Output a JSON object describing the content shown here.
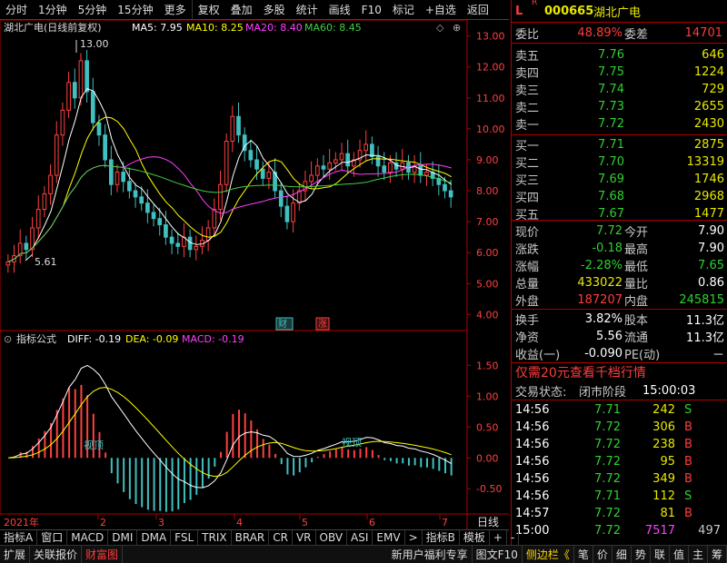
{
  "toolbar": {
    "items": [
      "分时",
      "1分钟",
      "5分钟",
      "15分钟",
      "更多",
      "复权",
      "叠加",
      "多股",
      "统计",
      "画线",
      "F10",
      "标记",
      "+自选",
      "返回"
    ]
  },
  "chart": {
    "legend": {
      "stock": "湖北广电(日线前复权)",
      "ma5": "MA5: 7.95",
      "ma10": "MA10: 8.25",
      "ma20": "MA20: 8.40",
      "ma60": "MA60: 8.45"
    },
    "max_label": "13.00",
    "min_label": "5.61",
    "price_ticks": [
      "13.00",
      "12.00",
      "11.00",
      "10.00",
      "9.00",
      "8.00",
      "7.00",
      "6.00",
      "5.00",
      "4.00"
    ],
    "markers": {
      "marker1": "财",
      "marker2": "涨"
    },
    "indicator": {
      "name": "指标公式",
      "diff": "DIFF: -0.19",
      "dea": "DEA: -0.09",
      "macd": "MACD: -0.19",
      "ticks": [
        "1.50",
        "1.00",
        "0.50",
        "0.00",
        "-0.50"
      ],
      "notes": [
        "视顶",
        "视顶"
      ]
    },
    "xaxis": {
      "year": "2021年",
      "months": [
        "2",
        "3",
        "4",
        "5",
        "6",
        "7"
      ],
      "period": "日线"
    },
    "colors": {
      "ma5": "#ffffff",
      "ma10": "#ffff00",
      "ma20": "#ff40ff",
      "ma60": "#40d040",
      "up": "#ff4040",
      "down": "#40c0c0"
    }
  },
  "panel": {
    "indicator_letter": "L",
    "r_badge": "R",
    "code": "000665",
    "name": "湖北广电",
    "weibi_label": "委比",
    "weibi_value": "48.89%",
    "weicha_label": "委差",
    "weicha_value": "14701",
    "asks": [
      {
        "label": "卖五",
        "price": "7.76",
        "vol": "646"
      },
      {
        "label": "卖四",
        "price": "7.75",
        "vol": "1224"
      },
      {
        "label": "卖三",
        "price": "7.74",
        "vol": "729"
      },
      {
        "label": "卖二",
        "price": "7.73",
        "vol": "2655"
      },
      {
        "label": "卖一",
        "price": "7.72",
        "vol": "2430"
      }
    ],
    "bids": [
      {
        "label": "买一",
        "price": "7.71",
        "vol": "2875"
      },
      {
        "label": "买二",
        "price": "7.70",
        "vol": "13319"
      },
      {
        "label": "买三",
        "price": "7.69",
        "vol": "1746"
      },
      {
        "label": "买四",
        "price": "7.68",
        "vol": "2968"
      },
      {
        "label": "买五",
        "price": "7.67",
        "vol": "1477"
      }
    ],
    "quote": [
      {
        "l1": "现价",
        "v1": "7.72",
        "l2": "今开",
        "v2": "7.90"
      },
      {
        "l1": "涨跌",
        "v1": "-0.18",
        "l2": "最高",
        "v2": "7.90"
      },
      {
        "l1": "涨幅",
        "v1": "-2.28%",
        "l2": "最低",
        "v2": "7.65"
      },
      {
        "l1": "总量",
        "v1": "433022",
        "l2": "量比",
        "v2": "0.86"
      },
      {
        "l1": "外盘",
        "v1": "187207",
        "l2": "内盘",
        "v2": "245815"
      }
    ],
    "stats": [
      {
        "l1": "换手",
        "v1": "3.82%",
        "l2": "股本",
        "v2": "11.3亿"
      },
      {
        "l1": "净资",
        "v1": "5.56",
        "l2": "流通",
        "v2": "11.3亿"
      },
      {
        "l1": "收益(一)",
        "v1": "-0.090",
        "l2": "PE(动)",
        "v2": "－"
      }
    ],
    "promo": "仅需20元查看千档行情",
    "trade_status_label": "交易状态:",
    "trade_status": "闭市阶段",
    "trade_time": "15:00:03",
    "ticks": [
      {
        "time": "14:56",
        "price": "7.71",
        "vol": "242",
        "side": "S"
      },
      {
        "time": "14:56",
        "price": "7.72",
        "vol": "306",
        "side": "B"
      },
      {
        "time": "14:56",
        "price": "7.72",
        "vol": "238",
        "side": "B"
      },
      {
        "time": "14:56",
        "price": "7.72",
        "vol": "95",
        "side": "B"
      },
      {
        "time": "14:56",
        "price": "7.72",
        "vol": "349",
        "side": "B"
      },
      {
        "time": "14:56",
        "price": "7.71",
        "vol": "112",
        "side": "S"
      },
      {
        "time": "14:57",
        "price": "7.72",
        "vol": "81",
        "side": "B"
      },
      {
        "time": "15:00",
        "price": "7.72",
        "vol": "7517",
        "side": "497"
      }
    ]
  },
  "tabs": [
    "指标A",
    "窗口",
    "MACD",
    "DMI",
    "DMA",
    "FSL",
    "TRIX",
    "BRAR",
    "CR",
    "VR",
    "OBV",
    "ASI",
    "EMV",
    ">",
    "指标B",
    "模板",
    "+",
    "-"
  ],
  "statusbar": {
    "left": [
      "扩展",
      "关联报价",
      "财富图"
    ],
    "right": [
      "新用户福利专享",
      "图文F10",
      "侧边栏《"
    ],
    "icons": [
      "笔",
      "价",
      "细",
      "势",
      "联",
      "值",
      "主",
      "筹"
    ]
  }
}
